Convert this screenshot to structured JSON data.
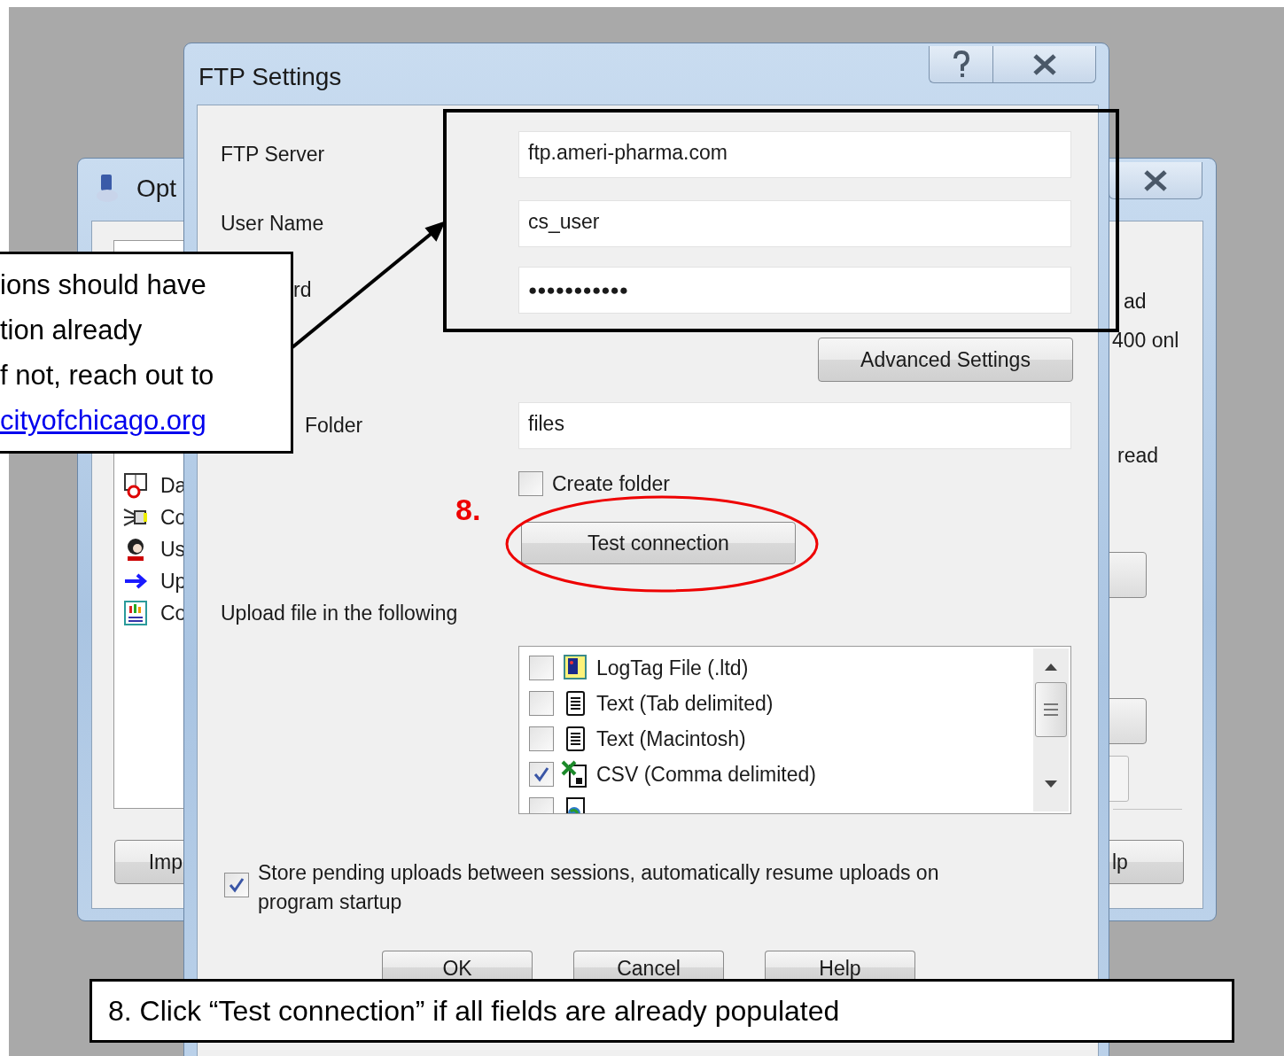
{
  "background_window": {
    "title": "Opt",
    "nav_items": [
      {
        "label": "Da",
        "kind": "date"
      },
      {
        "label": "Co",
        "kind": "connection"
      },
      {
        "label": "Us",
        "kind": "user"
      },
      {
        "label": "Up",
        "kind": "upload"
      },
      {
        "label": "Co",
        "kind": "report"
      }
    ],
    "right_texts": [
      "ad",
      "400 onl",
      "read"
    ],
    "buttons": [
      "Imp",
      "lp"
    ]
  },
  "dialog": {
    "title": "FTP Settings",
    "fields": [
      {
        "label": "FTP Server",
        "value": "ftp.ameri-pharma.com"
      },
      {
        "label": "User Name",
        "value": "cs_user"
      },
      {
        "label": "rd",
        "value": "●●●●●●●●●●●"
      }
    ],
    "advanced_button": "Advanced Settings",
    "folder": {
      "label": "Folder",
      "value": "files"
    },
    "create_folder": {
      "label": "Create folder",
      "checked": false
    },
    "test_button": "Test connection",
    "upload_label": "Upload file in the following",
    "file_types": [
      {
        "label": "LogTag File (.ltd)",
        "kind": "logtag",
        "checked": false
      },
      {
        "label": "Text (Tab delimited)",
        "kind": "text",
        "checked": false
      },
      {
        "label": "Text (Macintosh)",
        "kind": "text",
        "checked": false
      },
      {
        "label": "CSV (Comma delimited)",
        "kind": "spreadsheet",
        "checked": true
      },
      {
        "kind": "html",
        "checked": false
      }
    ],
    "store_pending": {
      "label": "Store pending uploads between sessions, automatically resume uploads on program startup",
      "checked": true
    },
    "buttons": [
      "OK",
      "Cancel",
      "Help"
    ]
  },
  "annotations": {
    "step_marker": "8.",
    "side_note": {
      "lines": [
        "ions should have",
        "tion already",
        "f not, reach out to"
      ],
      "link": "cityofchicago.org"
    },
    "caption": "8. Click “Test connection” if all fields are already populated"
  }
}
